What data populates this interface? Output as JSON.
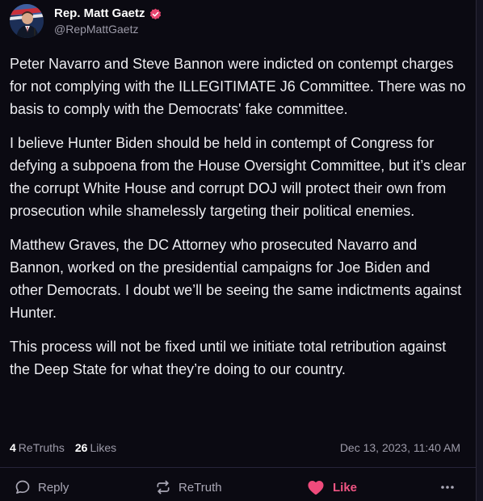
{
  "author": {
    "display_name": "Rep. Matt Gaetz",
    "handle": "@RepMattGaetz",
    "verified": true
  },
  "post": {
    "paragraphs": [
      "Peter Navarro and Steve Bannon were indicted on contempt charges for not complying with the ILLEGITIMATE J6 Committee. There was no basis to comply with the Democrats' fake committee.",
      "I believe Hunter Biden should be held in contempt of Congress for defying a subpoena from the House Oversight Committee, but it’s clear the corrupt White House and corrupt DOJ will protect their own from prosecution while shamelessly targeting their political enemies.",
      "Matthew Graves, the DC Attorney who prosecuted Navarro and Bannon, worked on the presidential campaigns for Joe Biden and other Democrats. I doubt we’ll be seeing the same indictments against Hunter.",
      "This process will not be fixed until we initiate total retribution against the Deep State for what they’re doing to our country."
    ]
  },
  "stats": {
    "retruths_count": "4",
    "retruths_label": "ReTruths",
    "likes_count": "26",
    "likes_label": "Likes",
    "timestamp": "Dec 13, 2023, 11:40 AM"
  },
  "actions": {
    "reply_label": "Reply",
    "retruth_label": "ReTruth",
    "like_label": "Like",
    "like_active": true
  },
  "colors": {
    "background": "#0b0a12",
    "accent_like": "#f25584",
    "verified": "#e8466f",
    "muted_text": "#9c9aa8"
  },
  "icons": {
    "avatar": "profile-photo",
    "verified": "verified-badge-icon",
    "reply": "speech-bubble-icon",
    "retruth": "repost-arrows-icon",
    "like": "heart-icon",
    "more": "ellipsis-icon"
  }
}
